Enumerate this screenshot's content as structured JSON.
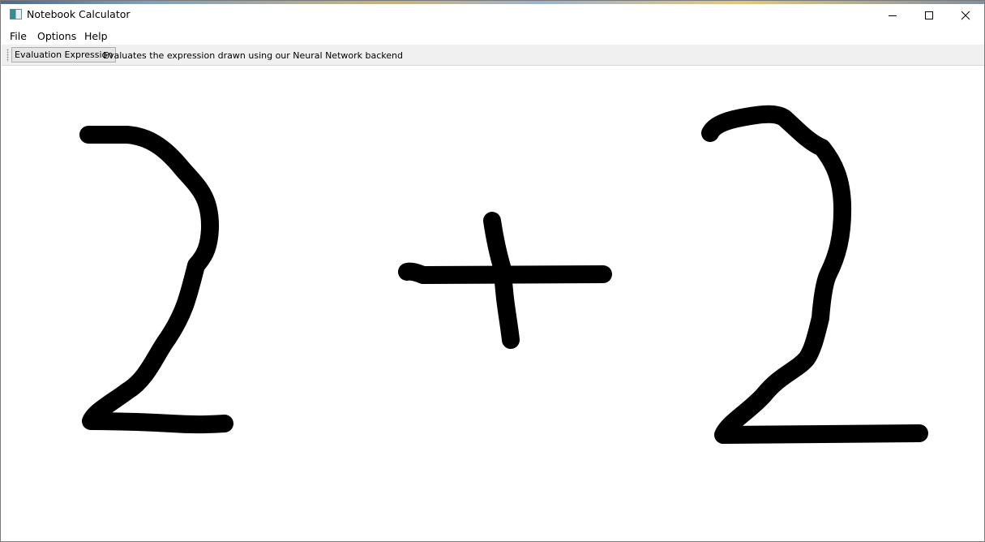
{
  "window": {
    "title": "Notebook Calculator",
    "controls": {
      "minimize": "minimize-icon",
      "maximize": "maximize-icon",
      "close": "close-icon"
    }
  },
  "menu": {
    "items": [
      "File",
      "Options",
      "Help"
    ]
  },
  "toolbar": {
    "button_label": "Evaluation Expression",
    "description": "Evaluates the expression drawn using our Neural Network backend"
  },
  "canvas": {
    "ink_color": "#000000",
    "strokes": [
      "digit-two-left",
      "plus-horizontal",
      "plus-vertical",
      "digit-two-right"
    ]
  }
}
